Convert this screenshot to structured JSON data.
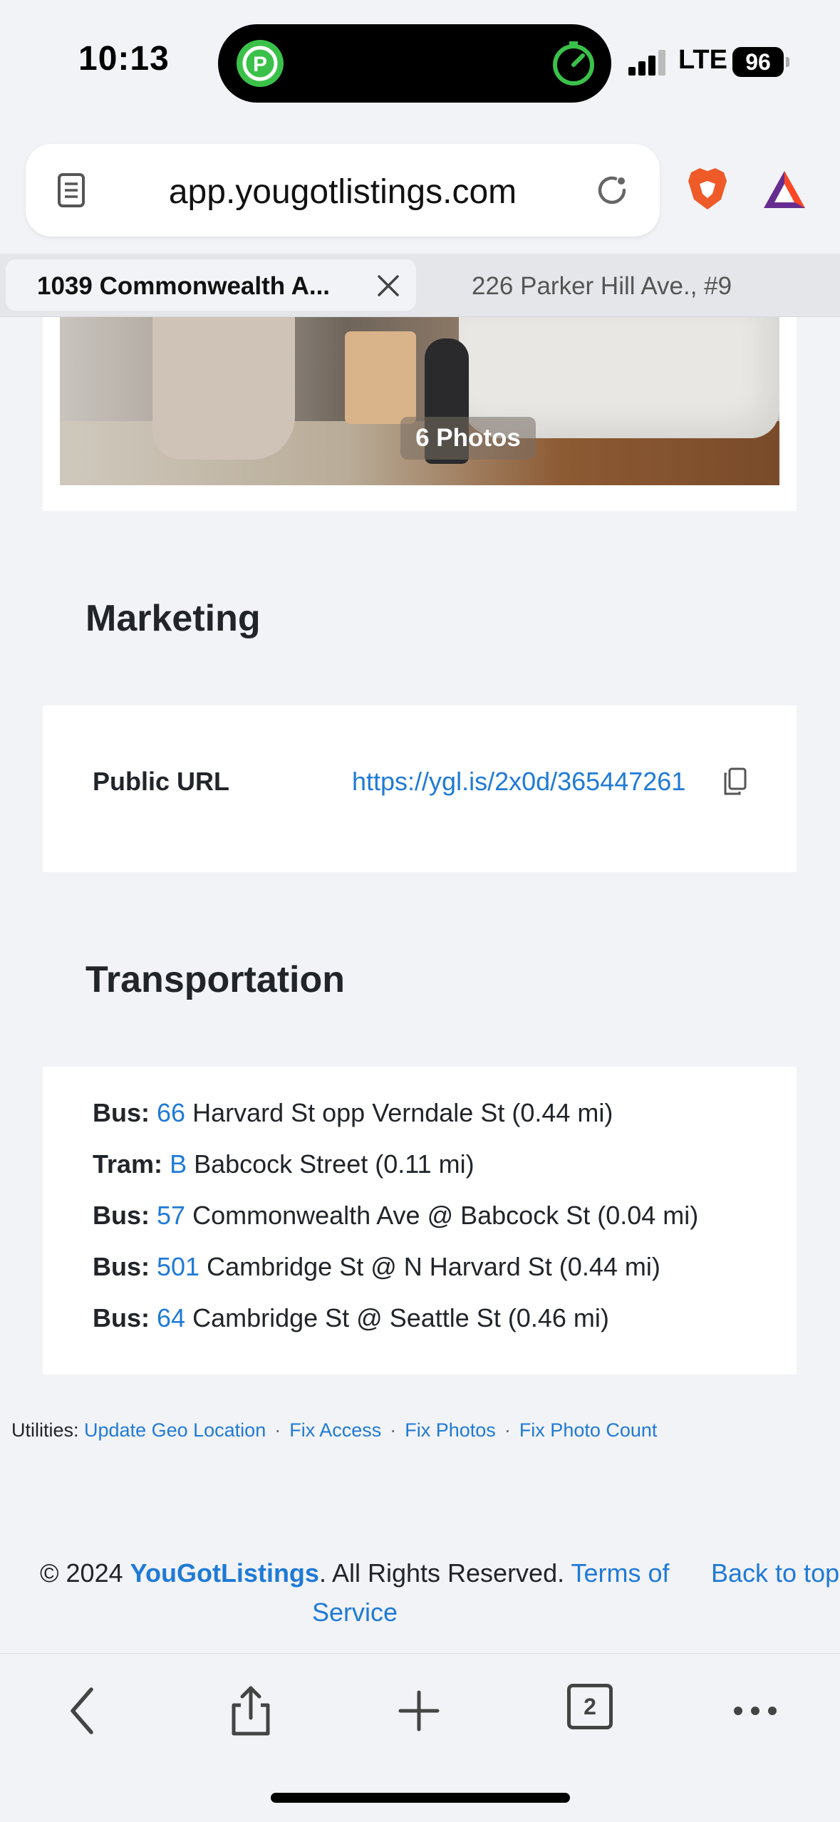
{
  "status_bar": {
    "time": "10:13",
    "network": "LTE",
    "battery": "96"
  },
  "browser": {
    "url": "app.yougotlistings.com",
    "tabs": [
      {
        "label": "1039 Commonwealth A...",
        "active": true
      },
      {
        "label": "226 Parker Hill Ave., #9",
        "active": false
      }
    ],
    "tab_count": "2"
  },
  "photos": {
    "badge": "6 Photos"
  },
  "marketing": {
    "title": "Marketing",
    "public_url_label": "Public URL",
    "public_url": "https://ygl.is/2x0d/365447261"
  },
  "transportation": {
    "title": "Transportation",
    "items": [
      {
        "mode": "Bus:",
        "route": "66",
        "stop": "Harvard St opp Verndale St (0.44 mi)"
      },
      {
        "mode": "Tram:",
        "route": "B",
        "stop": "Babcock Street (0.11 mi)"
      },
      {
        "mode": "Bus:",
        "route": "57",
        "stop": "Commonwealth Ave @ Babcock St (0.04 mi)"
      },
      {
        "mode": "Bus:",
        "route": "501",
        "stop": "Cambridge St @ N Harvard St (0.44 mi)"
      },
      {
        "mode": "Bus:",
        "route": "64",
        "stop": "Cambridge St @ Seattle St (0.46 mi)"
      }
    ]
  },
  "utilities": {
    "label": "Utilities:",
    "links": [
      "Update Geo Location",
      "Fix Access",
      "Fix Photos",
      "Fix Photo Count"
    ],
    "separator": "·"
  },
  "footer": {
    "copyright": "© 2024",
    "brand": "YouGotListings",
    "rights": ". All Rights Reserved.",
    "terms_part1": "Terms of",
    "terms_part2": "Service",
    "back_to_top": "Back to top"
  },
  "colors": {
    "link": "#1f7ad6",
    "background": "#f2f3f6"
  }
}
